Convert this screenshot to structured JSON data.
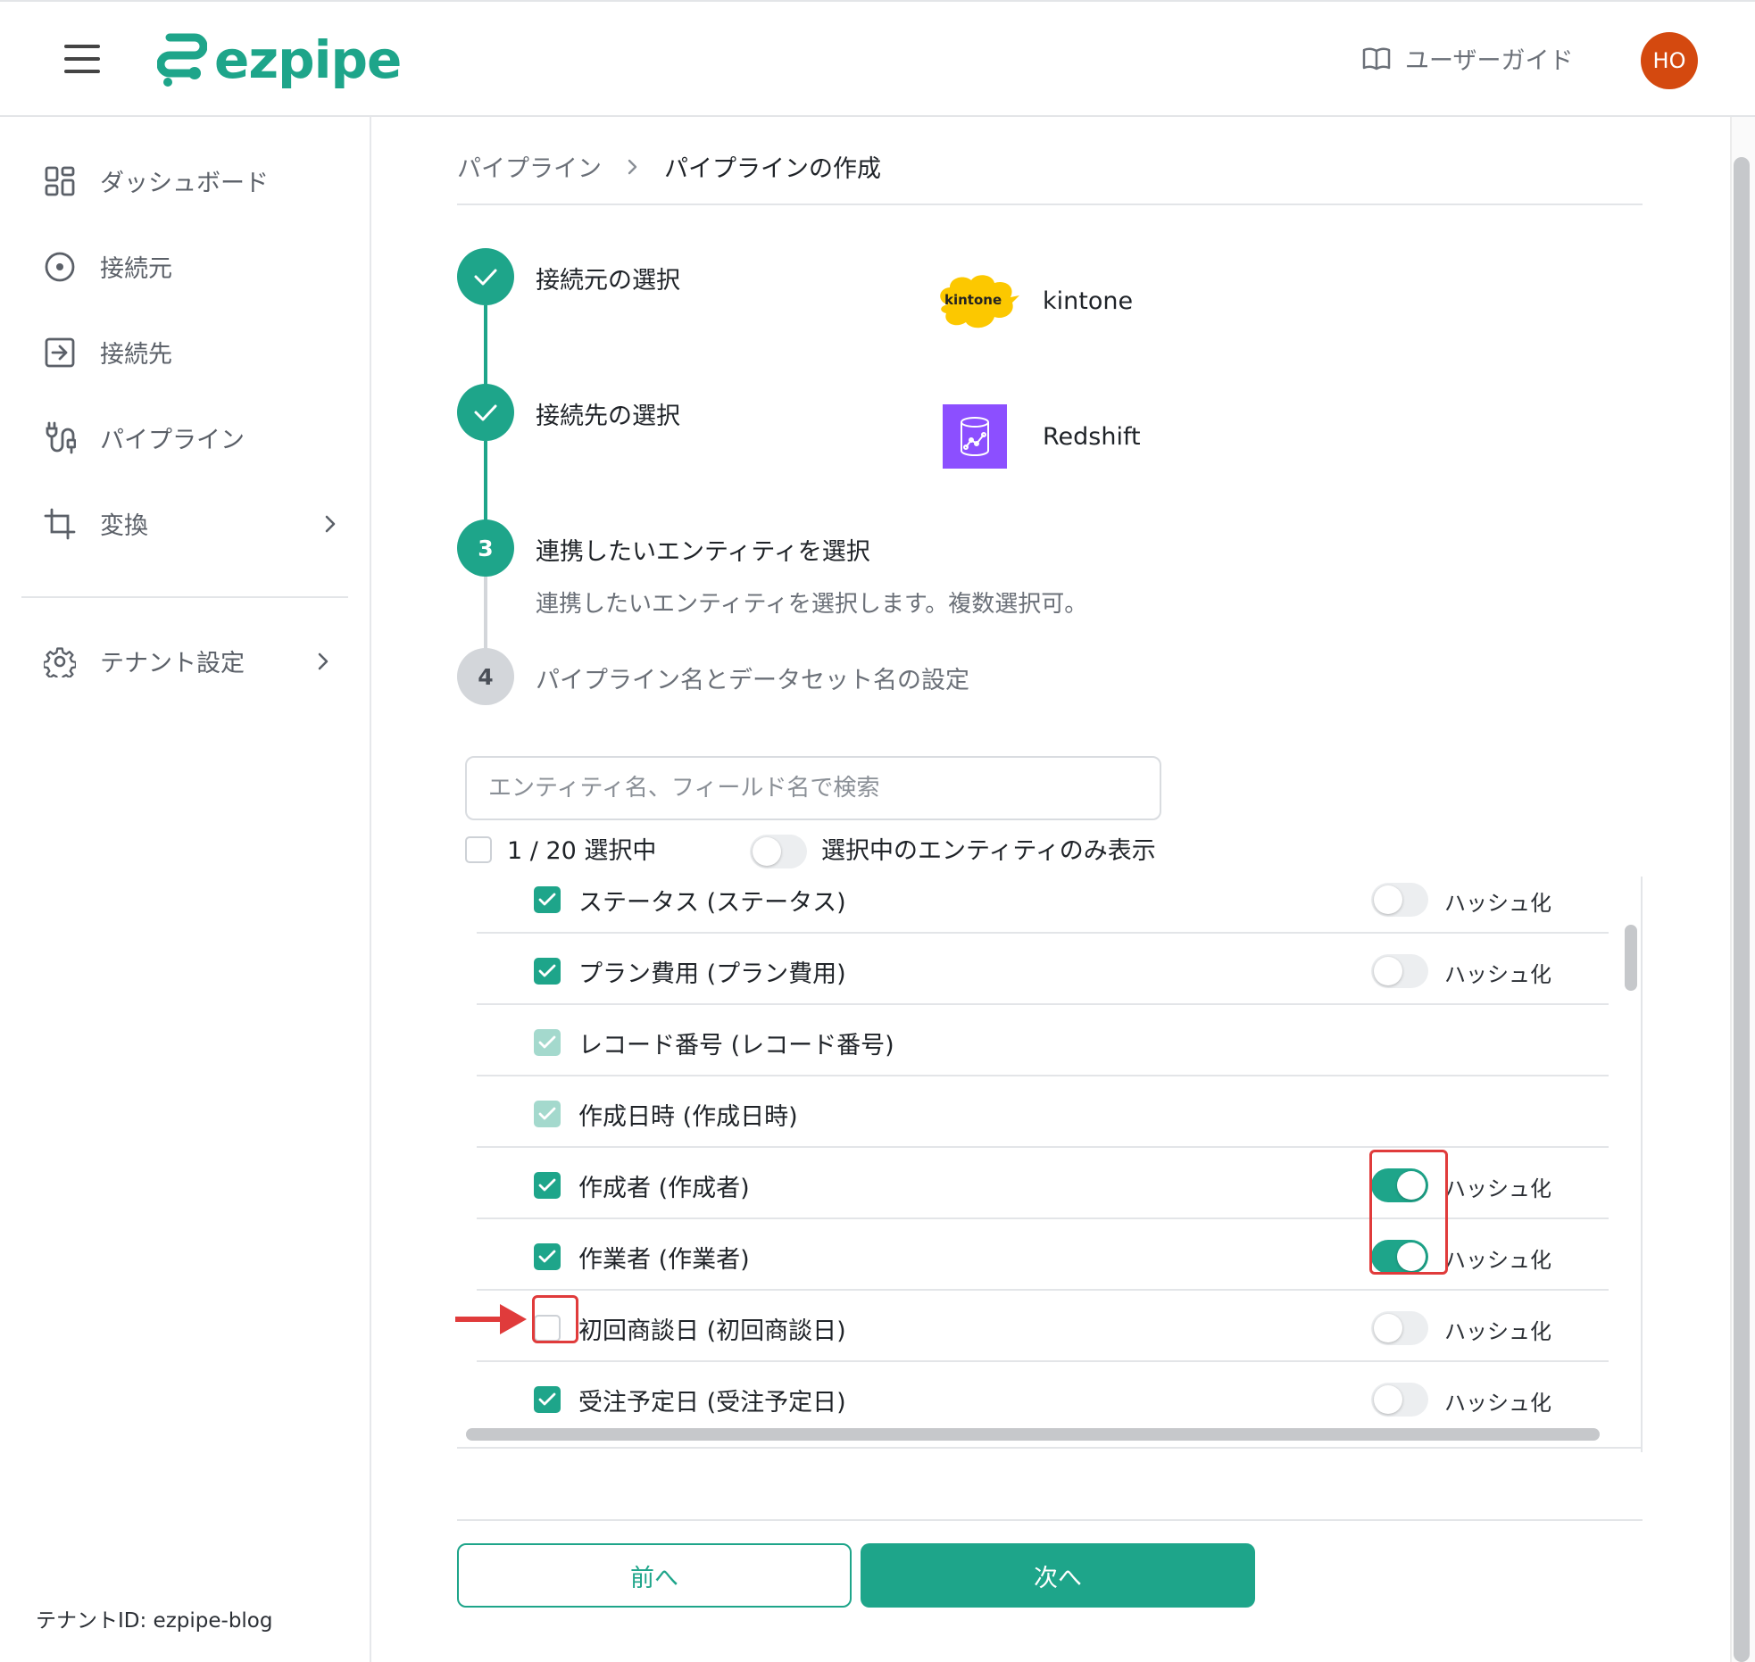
{
  "header": {
    "logo_text": "ezpipe",
    "guide_label": "ユーザーガイド",
    "avatar_initials": "HO",
    "brand_color": "#1ea58a",
    "avatar_color": "#d4490f"
  },
  "sidebar": {
    "items": [
      {
        "label": "ダッシュボード",
        "icon": "dashboard-icon"
      },
      {
        "label": "接続元",
        "icon": "source-icon"
      },
      {
        "label": "接続先",
        "icon": "destination-icon"
      },
      {
        "label": "パイプライン",
        "icon": "pipeline-icon"
      },
      {
        "label": "変換",
        "icon": "crop-icon",
        "has_submenu": true
      },
      {
        "label": "テナント設定",
        "icon": "gear-icon",
        "has_submenu": true
      }
    ],
    "tenant_id": "テナントID: ezpipe-blog"
  },
  "breadcrumb": {
    "parent": "パイプライン",
    "current": "パイプラインの作成"
  },
  "steps": [
    {
      "number": "1",
      "title": "接続元の選択",
      "status": "done",
      "service": "kintone"
    },
    {
      "number": "2",
      "title": "接続先の選択",
      "status": "done",
      "service": "Redshift"
    },
    {
      "number": "3",
      "title": "連携したいエンティティを選択",
      "status": "active",
      "description": "連携したいエンティティを選択します。複数選択可。"
    },
    {
      "number": "4",
      "title": "パイプライン名とデータセット名の設定",
      "status": "pending"
    }
  ],
  "kintone_logo_text": "kintone",
  "search": {
    "placeholder": "エンティティ名、フィールド名で検索",
    "value": ""
  },
  "selection": {
    "count_label": "1 / 20 選択中",
    "all_checked": false,
    "only_selected_label": "選択中のエンティティのみ表示",
    "only_selected_on": false
  },
  "fields": [
    {
      "label": "ステータス (ステータス)",
      "checked": "on",
      "hash": false,
      "hash_label": "ハッシュ化"
    },
    {
      "label": "プラン費用 (プラン費用)",
      "checked": "on",
      "hash": false,
      "hash_label": "ハッシュ化"
    },
    {
      "label": "レコード番号 (レコード番号)",
      "checked": "disabled",
      "hash": null
    },
    {
      "label": "作成日時 (作成日時)",
      "checked": "disabled",
      "hash": null
    },
    {
      "label": "作成者 (作成者)",
      "checked": "on",
      "hash": true,
      "hash_label": "ハッシュ化"
    },
    {
      "label": "作業者 (作業者)",
      "checked": "on",
      "hash": true,
      "hash_label": "ハッシュ化"
    },
    {
      "label": "初回商談日 (初回商談日)",
      "checked": "off",
      "hash": false,
      "hash_label": "ハッシュ化"
    },
    {
      "label": "受注予定日 (受注予定日)",
      "checked": "on",
      "hash": false,
      "hash_label": "ハッシュ化"
    }
  ],
  "buttons": {
    "prev": "前へ",
    "next": "次へ"
  },
  "annotation_color": "#e03b3b"
}
